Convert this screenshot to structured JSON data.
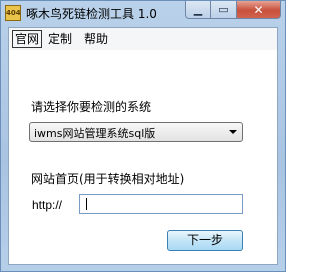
{
  "window": {
    "title": "啄木鸟死链检测工具 1.0",
    "icon_label": "404",
    "minimize_glyph": "▁",
    "maximize_glyph": "▭",
    "close_glyph": "✕"
  },
  "menu": {
    "items": [
      {
        "label": "官网",
        "selected": true
      },
      {
        "label": "定制",
        "selected": false
      },
      {
        "label": "帮助",
        "selected": false
      }
    ]
  },
  "form": {
    "system_prompt": "请选择你要检测的系统",
    "system_selected": "iwms网站管理系统sql版",
    "homepage_prompt": "网站首页(用于转换相对地址)",
    "url_prefix": "http://",
    "url_value": "",
    "next_label": "下一步"
  }
}
